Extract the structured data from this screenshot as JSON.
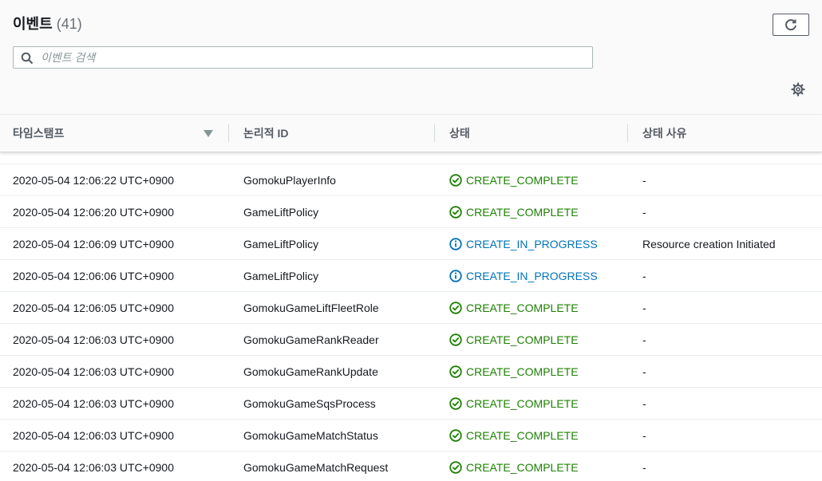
{
  "header": {
    "title": "이벤트",
    "count": "(41)"
  },
  "search": {
    "placeholder": "이벤트 검색",
    "value": ""
  },
  "icons": {
    "refresh": "refresh-icon",
    "search": "search-icon",
    "settings": "gear-icon",
    "sort": "caret-down-icon",
    "complete": "check-circle-icon",
    "in_progress": "info-circle-icon"
  },
  "colors": {
    "complete": "#1d8102",
    "in_progress": "#0073bb"
  },
  "table": {
    "columns": [
      {
        "label": "타임스탬프"
      },
      {
        "label": "논리적 ID"
      },
      {
        "label": "상태"
      },
      {
        "label": "상태 사유"
      }
    ],
    "rows": [
      {
        "timestamp": "2020-05-04 12:06:22 UTC+0900",
        "logical_id": "GomokuPlayerInfo",
        "status": "CREATE_COMPLETE",
        "status_type": "complete",
        "reason": "-"
      },
      {
        "timestamp": "2020-05-04 12:06:20 UTC+0900",
        "logical_id": "GameLiftPolicy",
        "status": "CREATE_COMPLETE",
        "status_type": "complete",
        "reason": "-"
      },
      {
        "timestamp": "2020-05-04 12:06:09 UTC+0900",
        "logical_id": "GameLiftPolicy",
        "status": "CREATE_IN_PROGRESS",
        "status_type": "in_progress",
        "reason": "Resource creation Initiated"
      },
      {
        "timestamp": "2020-05-04 12:06:06 UTC+0900",
        "logical_id": "GameLiftPolicy",
        "status": "CREATE_IN_PROGRESS",
        "status_type": "in_progress",
        "reason": "-"
      },
      {
        "timestamp": "2020-05-04 12:06:05 UTC+0900",
        "logical_id": "GomokuGameLiftFleetRole",
        "status": "CREATE_COMPLETE",
        "status_type": "complete",
        "reason": "-"
      },
      {
        "timestamp": "2020-05-04 12:06:03 UTC+0900",
        "logical_id": "GomokuGameRankReader",
        "status": "CREATE_COMPLETE",
        "status_type": "complete",
        "reason": "-"
      },
      {
        "timestamp": "2020-05-04 12:06:03 UTC+0900",
        "logical_id": "GomokuGameRankUpdate",
        "status": "CREATE_COMPLETE",
        "status_type": "complete",
        "reason": "-"
      },
      {
        "timestamp": "2020-05-04 12:06:03 UTC+0900",
        "logical_id": "GomokuGameSqsProcess",
        "status": "CREATE_COMPLETE",
        "status_type": "complete",
        "reason": "-"
      },
      {
        "timestamp": "2020-05-04 12:06:03 UTC+0900",
        "logical_id": "GomokuGameMatchStatus",
        "status": "CREATE_COMPLETE",
        "status_type": "complete",
        "reason": "-"
      },
      {
        "timestamp": "2020-05-04 12:06:03 UTC+0900",
        "logical_id": "GomokuGameMatchRequest",
        "status": "CREATE_COMPLETE",
        "status_type": "complete",
        "reason": "-"
      }
    ]
  }
}
